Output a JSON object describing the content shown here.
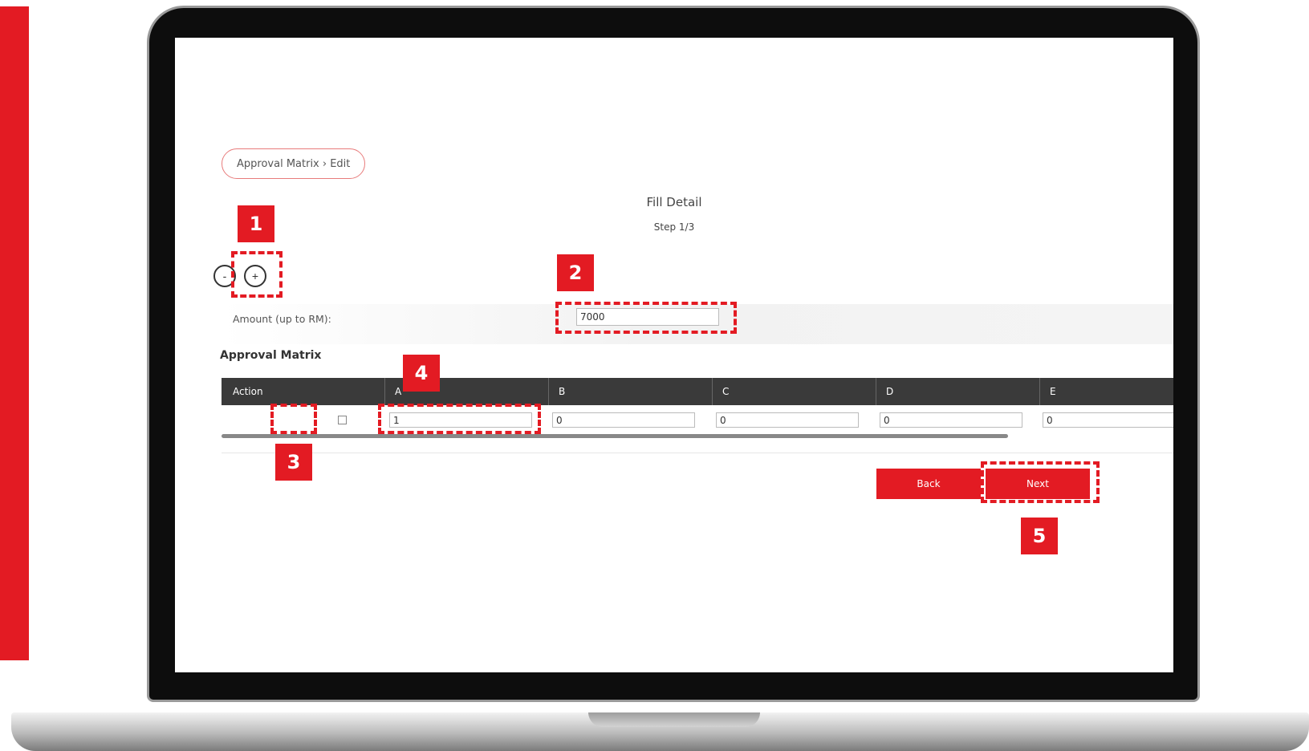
{
  "breadcrumb": "Approval Matrix › Edit",
  "header": {
    "title": "Fill Detail",
    "step": "Step 1/3"
  },
  "controls": {
    "minus": "-",
    "plus": "+"
  },
  "amount": {
    "label": "Amount (up to RM):",
    "value": "7000"
  },
  "matrix": {
    "title": "Approval Matrix",
    "columns": [
      "Action",
      "A",
      "B",
      "C",
      "D",
      "E"
    ],
    "row": {
      "checked": false,
      "values": [
        "1",
        "0",
        "0",
        "0",
        "0"
      ]
    }
  },
  "buttons": {
    "back": "Back",
    "next": "Next"
  },
  "callouts": [
    "1",
    "2",
    "3",
    "4",
    "5"
  ],
  "colors": {
    "accent": "#e31b23",
    "header": "#3a3a3a"
  }
}
